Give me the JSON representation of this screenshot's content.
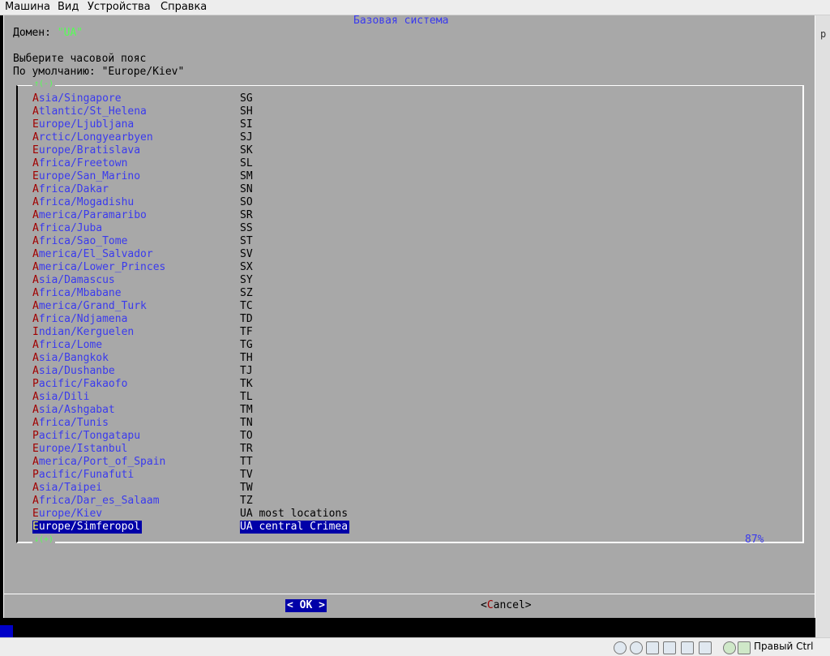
{
  "host_menu": [
    "Машина",
    "Вид",
    "Устройства",
    "Справка"
  ],
  "dialog": {
    "title": "Базовая система",
    "domain_label": "Домен: ",
    "domain_value": "\"UA\"",
    "prompt": "Выберите часовой пояс",
    "default_label": "По умолчанию: ",
    "default_value": "\"Europe/Kiev\"",
    "scroll_up": "↑(-)",
    "scroll_down": "↓(+)",
    "scroll_percent": "87%",
    "ok_label": "OK",
    "cancel_label": "Cancel"
  },
  "timezones": [
    {
      "zone": "Asia/Singapore",
      "code": "SG"
    },
    {
      "zone": "Atlantic/St_Helena",
      "code": "SH"
    },
    {
      "zone": "Europe/Ljubljana",
      "code": "SI"
    },
    {
      "zone": "Arctic/Longyearbyen",
      "code": "SJ"
    },
    {
      "zone": "Europe/Bratislava",
      "code": "SK"
    },
    {
      "zone": "Africa/Freetown",
      "code": "SL"
    },
    {
      "zone": "Europe/San_Marino",
      "code": "SM"
    },
    {
      "zone": "Africa/Dakar",
      "code": "SN"
    },
    {
      "zone": "Africa/Mogadishu",
      "code": "SO"
    },
    {
      "zone": "America/Paramaribo",
      "code": "SR"
    },
    {
      "zone": "Africa/Juba",
      "code": "SS"
    },
    {
      "zone": "Africa/Sao_Tome",
      "code": "ST"
    },
    {
      "zone": "America/El_Salvador",
      "code": "SV"
    },
    {
      "zone": "America/Lower_Princes",
      "code": "SX"
    },
    {
      "zone": "Asia/Damascus",
      "code": "SY"
    },
    {
      "zone": "Africa/Mbabane",
      "code": "SZ"
    },
    {
      "zone": "America/Grand_Turk",
      "code": "TC"
    },
    {
      "zone": "Africa/Ndjamena",
      "code": "TD"
    },
    {
      "zone": "Indian/Kerguelen",
      "code": "TF"
    },
    {
      "zone": "Africa/Lome",
      "code": "TG"
    },
    {
      "zone": "Asia/Bangkok",
      "code": "TH"
    },
    {
      "zone": "Asia/Dushanbe",
      "code": "TJ"
    },
    {
      "zone": "Pacific/Fakaofo",
      "code": "TK"
    },
    {
      "zone": "Asia/Dili",
      "code": "TL"
    },
    {
      "zone": "Asia/Ashgabat",
      "code": "TM"
    },
    {
      "zone": "Africa/Tunis",
      "code": "TN"
    },
    {
      "zone": "Pacific/Tongatapu",
      "code": "TO"
    },
    {
      "zone": "Europe/Istanbul",
      "code": "TR"
    },
    {
      "zone": "America/Port_of_Spain",
      "code": "TT"
    },
    {
      "zone": "Pacific/Funafuti",
      "code": "TV"
    },
    {
      "zone": "Asia/Taipei",
      "code": "TW"
    },
    {
      "zone": "Africa/Dar_es_Salaam",
      "code": "TZ"
    },
    {
      "zone": "Europe/Kiev",
      "code": "UA most locations"
    },
    {
      "zone": "Europe/Simferopol",
      "code": "UA central Crimea",
      "selected": true
    }
  ],
  "host_status": {
    "hostkey_label": "Правый Ctrl"
  },
  "side_strip_text": "p"
}
